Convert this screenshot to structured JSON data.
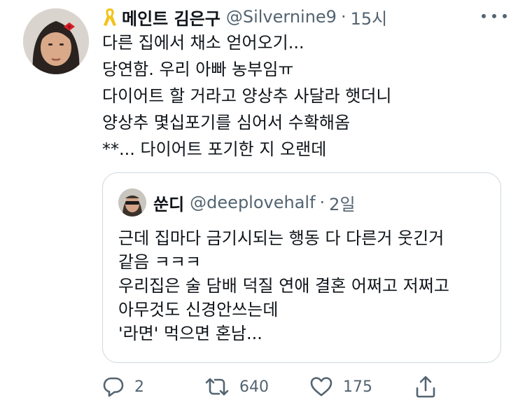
{
  "tweet": {
    "display_name": "메인트 김은구",
    "handle": "@Silvernine9",
    "separator": "·",
    "time": "15시",
    "lines": [
      "다른 집에서 채소 얻어오기...",
      "당연함. 우리 아빠 농부임ㅠ",
      "다이어트 할 거라고 양상추 사달라 햇더니",
      "양상추 몇십포기를 심어서 수확해옴",
      "**... 다이어트 포기한 지 오랜데"
    ]
  },
  "quoted": {
    "display_name": "쑨디",
    "handle": "@deeplovehalf",
    "separator": "·",
    "time": "2일",
    "lines": [
      "근데 집마다 금기시되는 행동 다 다른거 웃긴거",
      "같음 ㅋㅋㅋ",
      "우리집은 술 담배 덕질 연애 결혼 어쩌고 저쩌고",
      "아무것도 신경안쓰는데",
      "'라면' 먹으면 혼남..."
    ]
  },
  "actions": {
    "reply_count": "2",
    "retweet_count": "640",
    "like_count": "175"
  },
  "icons": {
    "ribbon": "yellow-ribbon-icon",
    "more": "more-icon",
    "reply": "reply-icon",
    "retweet": "retweet-icon",
    "like": "heart-icon",
    "share": "share-icon"
  },
  "colors": {
    "text": "#0f1419",
    "secondary": "#536471",
    "border": "#cfd9de",
    "ribbon": "#f2c31a"
  }
}
